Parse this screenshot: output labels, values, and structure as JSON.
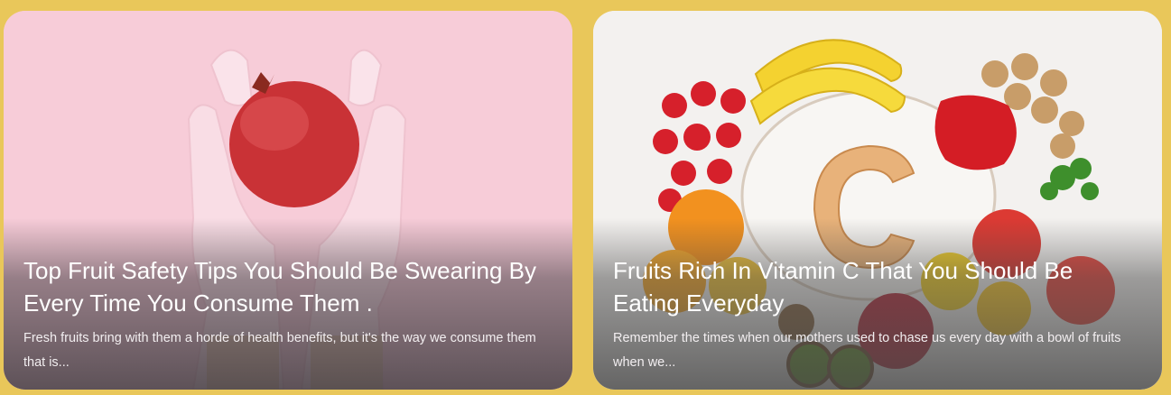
{
  "cards": [
    {
      "title": "Top Fruit Safety Tips You Should Be Swearing By Every Time You Consume Them .",
      "excerpt": "Fresh fruits bring with them a horde of health benefits, but it's the way we consume them that is...",
      "image": "pomegranate-in-gloved-hands"
    },
    {
      "title": "Fruits Rich In Vitamin C That You Should Be Eating Everyday",
      "excerpt": "Remember the times when our mothers used to chase us every day with a bowl of fruits when we...",
      "image": "vitamin-c-fruits-flatlay"
    }
  ],
  "colors": {
    "page_background": "#e9c75a",
    "card1_background": "#f6cdd8",
    "card2_background": "#f2f0ee"
  }
}
